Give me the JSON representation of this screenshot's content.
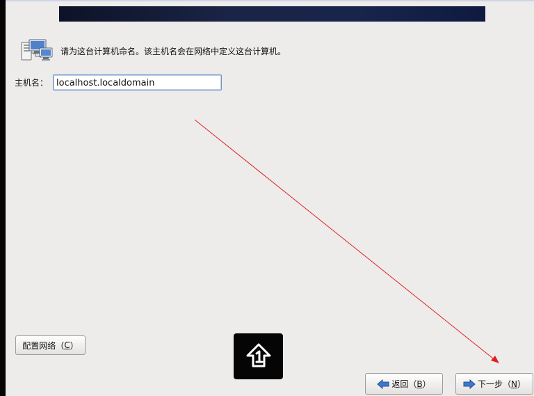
{
  "installer": {
    "intro_text": "请为这台计算机命名。该主机名会在网络中定义这台计算机。",
    "hostname_label": "主机名：",
    "hostname_value": "localhost.localdomain",
    "configure_network": {
      "label": "配置网络（",
      "mnemonic": "C",
      "suffix": "）"
    },
    "back_button": {
      "label": "返回（",
      "mnemonic": "B",
      "suffix": "）"
    },
    "next_button": {
      "label": "下一步（",
      "mnemonic": "N",
      "suffix": "）"
    }
  },
  "icons": {
    "header": "network-computers-icon",
    "back": "left-arrow-icon",
    "next": "right-arrow-icon",
    "badge": "upload-icon"
  },
  "colors": {
    "window_background": "#edeceb",
    "header_banner": "#18244a",
    "input_border": "#6f94c6",
    "arrow_blue": "#3f79c9",
    "annotation_arrow": "#e02020",
    "badge_background": "#050505"
  }
}
